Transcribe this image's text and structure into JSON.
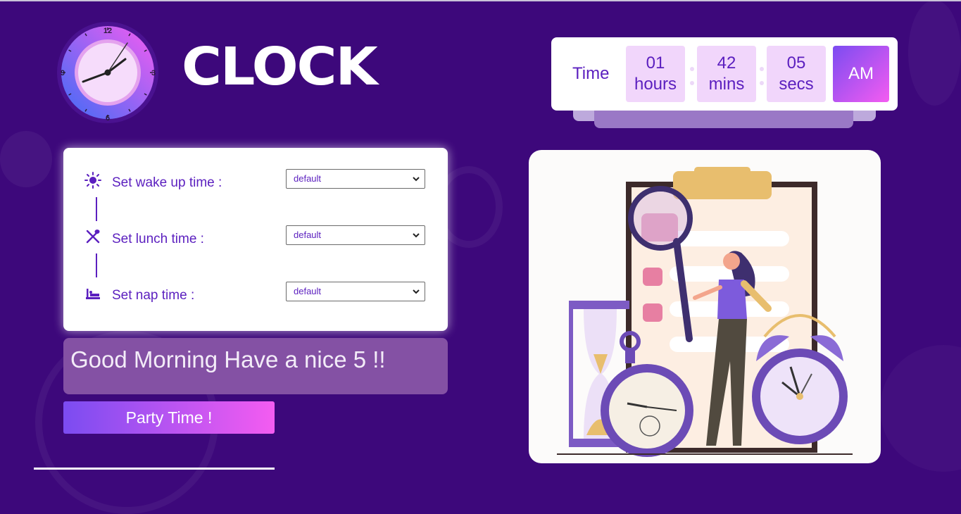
{
  "brand": {
    "title": "CLOCK"
  },
  "time_widget": {
    "label": "Time",
    "hours_value": "01",
    "hours_unit": "hours",
    "mins_value": "42",
    "mins_unit": "mins",
    "secs_value": "05",
    "secs_unit": "secs",
    "period": "AM"
  },
  "settings": {
    "rows": [
      {
        "label": "Set wake up time :",
        "icon": "sun-icon",
        "select_value": "default"
      },
      {
        "label": "Set lunch time :",
        "icon": "utensils-icon",
        "select_value": "default"
      },
      {
        "label": "Set nap time :",
        "icon": "bed-icon",
        "select_value": "default"
      }
    ]
  },
  "greeting": {
    "text": "Good Morning Have a nice 5 !!"
  },
  "party_button": {
    "label": "Party Time !"
  },
  "logo_clock": {
    "numerals": [
      "12",
      "3",
      "6",
      "9"
    ]
  },
  "colors": {
    "background": "#3d087b",
    "accent": "#5b1fbf",
    "gradient_start": "#7b4cf1",
    "gradient_end": "#f45cf1"
  }
}
